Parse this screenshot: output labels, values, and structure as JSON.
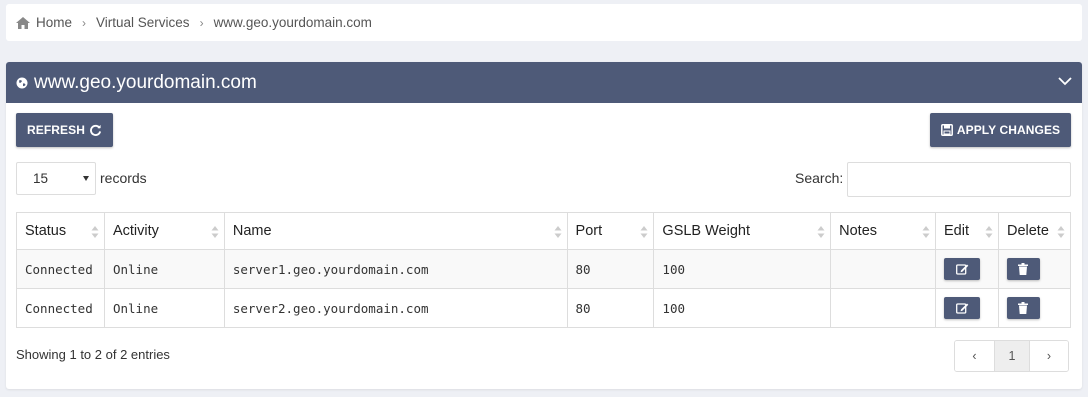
{
  "breadcrumb": {
    "items": [
      "Home",
      "Virtual Services",
      "www.geo.yourdomain.com"
    ]
  },
  "panel": {
    "title": "www.geo.yourdomain.com"
  },
  "toolbar": {
    "refresh_label": "REFRESH",
    "apply_label": "APPLY CHANGES"
  },
  "length": {
    "value": "15",
    "label": "records"
  },
  "search": {
    "label": "Search:",
    "value": ""
  },
  "table": {
    "columns": [
      "Status",
      "Activity",
      "Name",
      "Port",
      "GSLB Weight",
      "Notes",
      "Edit",
      "Delete"
    ],
    "rows": [
      {
        "status": "Connected",
        "activity": "Online",
        "name": "server1.geo.yourdomain.com",
        "port": "80",
        "weight": "100",
        "notes": ""
      },
      {
        "status": "Connected",
        "activity": "Online",
        "name": "server2.geo.yourdomain.com",
        "port": "80",
        "weight": "100",
        "notes": ""
      }
    ]
  },
  "footer": {
    "info": "Showing 1 to 2 of 2 entries",
    "pagination": {
      "prev": "‹",
      "current": "1",
      "next": "›"
    }
  },
  "colors": {
    "accent": "#4e5a78",
    "background": "#eef0f5"
  }
}
